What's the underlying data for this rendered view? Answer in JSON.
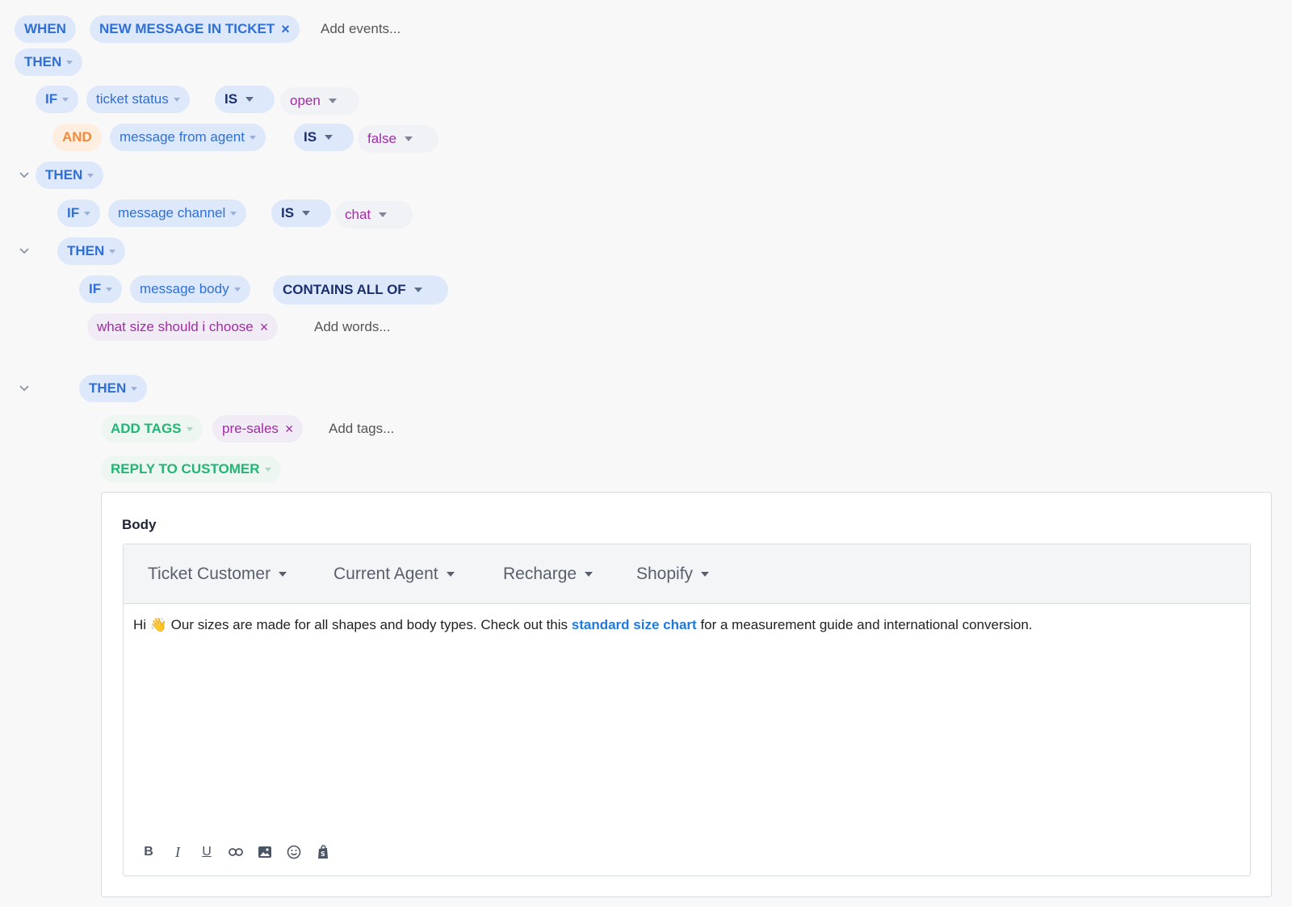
{
  "when": {
    "keyword": "WHEN",
    "event": "NEW MESSAGE IN TICKET",
    "add_placeholder": "Add events..."
  },
  "then_label": "THEN",
  "if_label": "IF",
  "and_label": "AND",
  "block1": {
    "field": "ticket status",
    "op": "IS",
    "value": "open",
    "and_field": "message from agent",
    "and_op": "IS",
    "and_value": "false"
  },
  "block2": {
    "field": "message channel",
    "op": "IS",
    "value": "chat"
  },
  "block3": {
    "field": "message body",
    "op": "CONTAINS ALL OF",
    "word": "what size should i choose",
    "add_placeholder": "Add words..."
  },
  "actions": {
    "add_tags": "ADD TAGS",
    "tag": "pre-sales",
    "add_tags_placeholder": "Add tags...",
    "reply": "REPLY TO CUSTOMER"
  },
  "editor": {
    "body_label": "Body",
    "variables": [
      "Ticket Customer",
      "Current Agent",
      "Recharge",
      "Shopify"
    ],
    "message_before": "Hi 👋  Our sizes are made for all shapes and body types. Check out this ",
    "message_link": "standard size chart",
    "message_after": " for a measurement guide and international conversion."
  }
}
